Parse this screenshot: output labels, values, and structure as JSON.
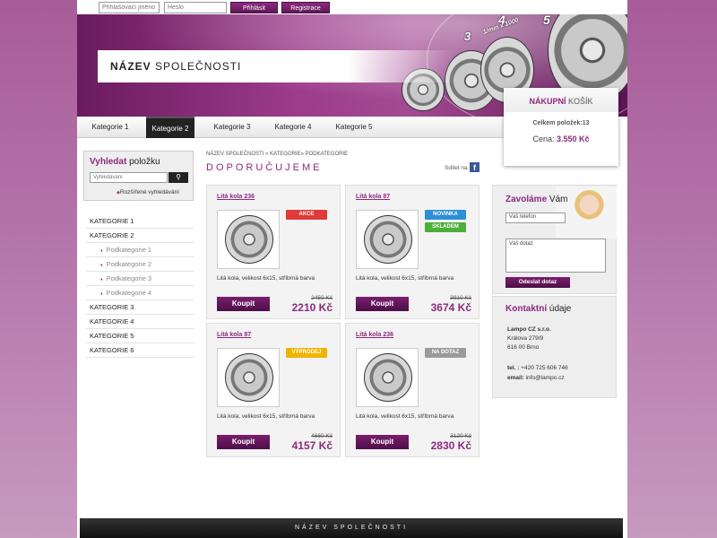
{
  "login": {
    "username_placeholder": "Přihlašovací jméno",
    "password_placeholder": "Heslo",
    "login_label": "Přihlásit",
    "register_label": "Registrace"
  },
  "header": {
    "company_bold": "NÁZEV",
    "company_rest": " SPOLEČNOSTI",
    "dial_numbers": [
      "3",
      "4",
      "5",
      "1/min x 1000"
    ]
  },
  "cart": {
    "title_bold": "NÁKUPNÍ",
    "title_rest": " KOŠÍK",
    "count_text": "Celkem položek:13",
    "price_label": "Cena: ",
    "price_value": "3.550 Kč"
  },
  "nav": {
    "items": [
      "Kategorie 1",
      "Kategorie 2",
      "Kategorie 3",
      "Kategorie 4",
      "Kategorie 5"
    ],
    "active": "Kategorie 2"
  },
  "search": {
    "title_bold": "Vyhledat",
    "title_rest": " položku",
    "placeholder": "Vyhledávání",
    "button_icon": "search-icon",
    "advanced_link": "Rozšířené vyhledávání"
  },
  "categories": [
    {
      "label": "KATEGORIE 1",
      "sub": false
    },
    {
      "label": "KATEGORIE 2",
      "sub": false
    },
    {
      "label": "Podkategorie 1",
      "sub": true
    },
    {
      "label": "Podkategorie 2",
      "sub": true
    },
    {
      "label": "Podkategorie 3",
      "sub": true
    },
    {
      "label": "Podkategorie 4",
      "sub": true
    },
    {
      "label": "KATEGORIE 3",
      "sub": false
    },
    {
      "label": "KATEGORIE 4",
      "sub": false
    },
    {
      "label": "KATEGORIE 5",
      "sub": false
    },
    {
      "label": "KATEGORIE 6",
      "sub": false
    }
  ],
  "main": {
    "breadcrumb": "NÁZEV SPOLEČNOSTI » KATEGORIE» PODKATEGORIE",
    "title": "DOPORUČUJEME",
    "share_label": "Sdílet na",
    "share_icon": "facebook-icon"
  },
  "products": [
    {
      "title": "Litá kola 236",
      "badges": [
        {
          "label": "AKCE",
          "color": "#e03a3a"
        }
      ],
      "desc": "Litá kola, velikost 6x15, stříbrná barva",
      "buy": "Koupit",
      "old_price": "2450 Kč",
      "price": "2210 Kč"
    },
    {
      "title": "Litá kola 87",
      "badges": [
        {
          "label": "NOVINKA",
          "color": "#2d8fd5"
        },
        {
          "label": "SKLADEM",
          "color": "#4caf3a"
        }
      ],
      "desc": "Litá kola, velikost 6x15, stříbrná barva",
      "buy": "Koupit",
      "old_price": "3910 Kč",
      "price": "3674 Kč"
    },
    {
      "title": "Litá kola 87",
      "badges": [
        {
          "label": "VÝPRODEJ",
          "color": "#f0b400"
        }
      ],
      "desc": "Litá kola, velikost 6x15, stříbrná barva",
      "buy": "Koupit",
      "old_price": "4660 Kč",
      "price": "4157 Kč"
    },
    {
      "title": "Litá kola 236",
      "badges": [
        {
          "label": "NA DOTAZ",
          "color": "#9a9a9a"
        }
      ],
      "desc": "Litá kola, velikost 6x15, stříbrná barva",
      "buy": "Koupit",
      "old_price": "3120 Kč",
      "price": "2830 Kč"
    }
  ],
  "callback": {
    "title_bold": "Zavoláme",
    "title_rest": " Vám",
    "phone_placeholder": "Váš telefon",
    "message_placeholder": "Váš dotaz",
    "send_label": "Odeslat dotaz"
  },
  "contact": {
    "title_bold": "Kontaktní",
    "title_rest": " údaje",
    "company": "Lampo CZ s.r.o.",
    "street": "Králova 279/9",
    "city": "616 00 Brno",
    "tel_label": "tel. :",
    "tel": " +420 725 606 746",
    "email_label": "email:",
    "email": " info@lampo.cz"
  },
  "footer": {
    "text": "NÁZEV SPOLEČNOSTI"
  },
  "colors": {
    "accent": "#8c2a80",
    "dark": "#222222"
  }
}
